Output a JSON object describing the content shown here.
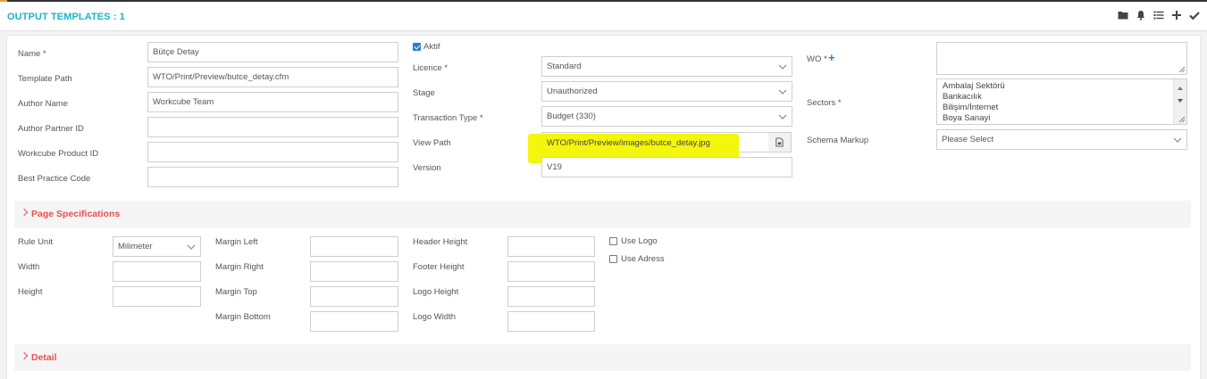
{
  "header": {
    "title": "OUTPUT TEMPLATES : 1",
    "icons": [
      "folder-icon",
      "bell-icon",
      "list-icon",
      "plus-icon",
      "check-icon"
    ]
  },
  "form": {
    "name": {
      "label": "Name *",
      "value": "Bütçe Detay"
    },
    "template_path": {
      "label": "Template Path",
      "value": "WTO/Print/Preview/butce_detay.cfm"
    },
    "author_name": {
      "label": "Author Name",
      "value": "Workcube Team"
    },
    "author_partner_id": {
      "label": "Author Partner ID",
      "value": ""
    },
    "workcube_product_id": {
      "label": "Workcube Product ID",
      "value": ""
    },
    "best_practice_code": {
      "label": "Best Practice Code",
      "value": ""
    },
    "aktif": {
      "label": "Aktif",
      "checked": true
    },
    "licence": {
      "label": "Licence *",
      "value": "Standard"
    },
    "stage": {
      "label": "Stage",
      "value": "Unauthorized"
    },
    "transaction_type": {
      "label": "Transaction Type *",
      "value": "Budget (330)"
    },
    "view_path": {
      "label": "View Path",
      "value": "WTO/Print/Preview/images/butce_detay.jpg"
    },
    "version": {
      "label": "Version",
      "value": "V19"
    },
    "wo": {
      "label": "WO *",
      "value": ""
    },
    "sectors": {
      "label": "Sectors *",
      "options": [
        "Ambalaj Sektörü",
        "Bankacılık",
        "Bilişim/İnternet",
        "Boya Sanayi"
      ]
    },
    "schema_markup": {
      "label": "Schema Markup",
      "value": "Please Select"
    }
  },
  "page_specifications": {
    "title": "Page Specifications",
    "rule_unit": {
      "label": "Rule Unit",
      "value": "Milimeter"
    },
    "width": {
      "label": "Width",
      "value": ""
    },
    "height": {
      "label": "Height",
      "value": ""
    },
    "margin_left": {
      "label": "Margin Left",
      "value": ""
    },
    "margin_right": {
      "label": "Margin Right",
      "value": ""
    },
    "margin_top": {
      "label": "Margin Top",
      "value": ""
    },
    "margin_bottom": {
      "label": "Margin Bottom",
      "value": ""
    },
    "header_height": {
      "label": "Header Height",
      "value": ""
    },
    "footer_height": {
      "label": "Footer Height",
      "value": ""
    },
    "logo_height": {
      "label": "Logo Height",
      "value": ""
    },
    "logo_width": {
      "label": "Logo Width",
      "value": ""
    },
    "use_logo": {
      "label": "Use Logo",
      "checked": false
    },
    "use_adress": {
      "label": "Use Adress",
      "checked": false
    }
  },
  "detail": {
    "title": "Detail"
  },
  "colors": {
    "title": "#1db3c6",
    "section_title": "#e4524f",
    "highlight": "#f3f500",
    "checkbox": "#2a7fd4"
  }
}
